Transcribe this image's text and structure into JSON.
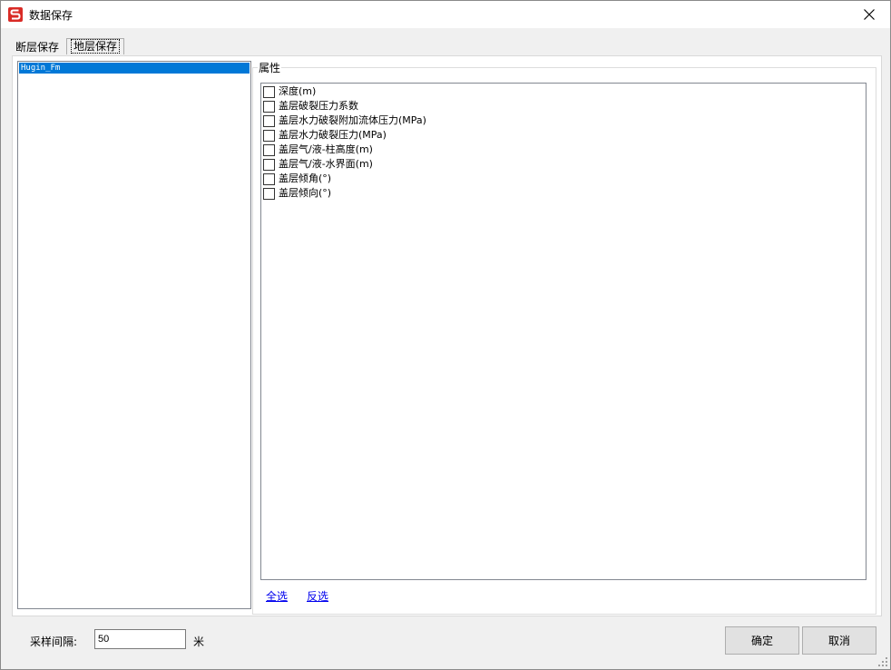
{
  "window": {
    "title": "数据保存"
  },
  "tabs": [
    {
      "label": "断层保存",
      "active": false
    },
    {
      "label": "地层保存",
      "active": true
    }
  ],
  "layers": {
    "items": [
      "Hugin_Fm"
    ],
    "selected_index": 0
  },
  "properties": {
    "group_label": "属性",
    "items": [
      {
        "label": "深度(m)",
        "checked": false
      },
      {
        "label": "盖层破裂压力系数",
        "checked": false
      },
      {
        "label": "盖层水力破裂附加流体压力(MPa)",
        "checked": false
      },
      {
        "label": "盖层水力破裂压力(MPa)",
        "checked": false
      },
      {
        "label": "盖层气/液-柱高度(m)",
        "checked": false
      },
      {
        "label": "盖层气/液-水界面(m)",
        "checked": false
      },
      {
        "label": "盖层倾角(°)",
        "checked": false
      },
      {
        "label": "盖层倾向(°)",
        "checked": false
      }
    ],
    "select_all_label": "全选",
    "invert_label": "反选"
  },
  "sampling": {
    "label": "采样间隔:",
    "value": "50",
    "unit": "米"
  },
  "buttons": {
    "ok": "确定",
    "cancel": "取消"
  },
  "colors": {
    "selection": "#0078d7",
    "logo": "#d92b26",
    "link": "#0000ee"
  }
}
